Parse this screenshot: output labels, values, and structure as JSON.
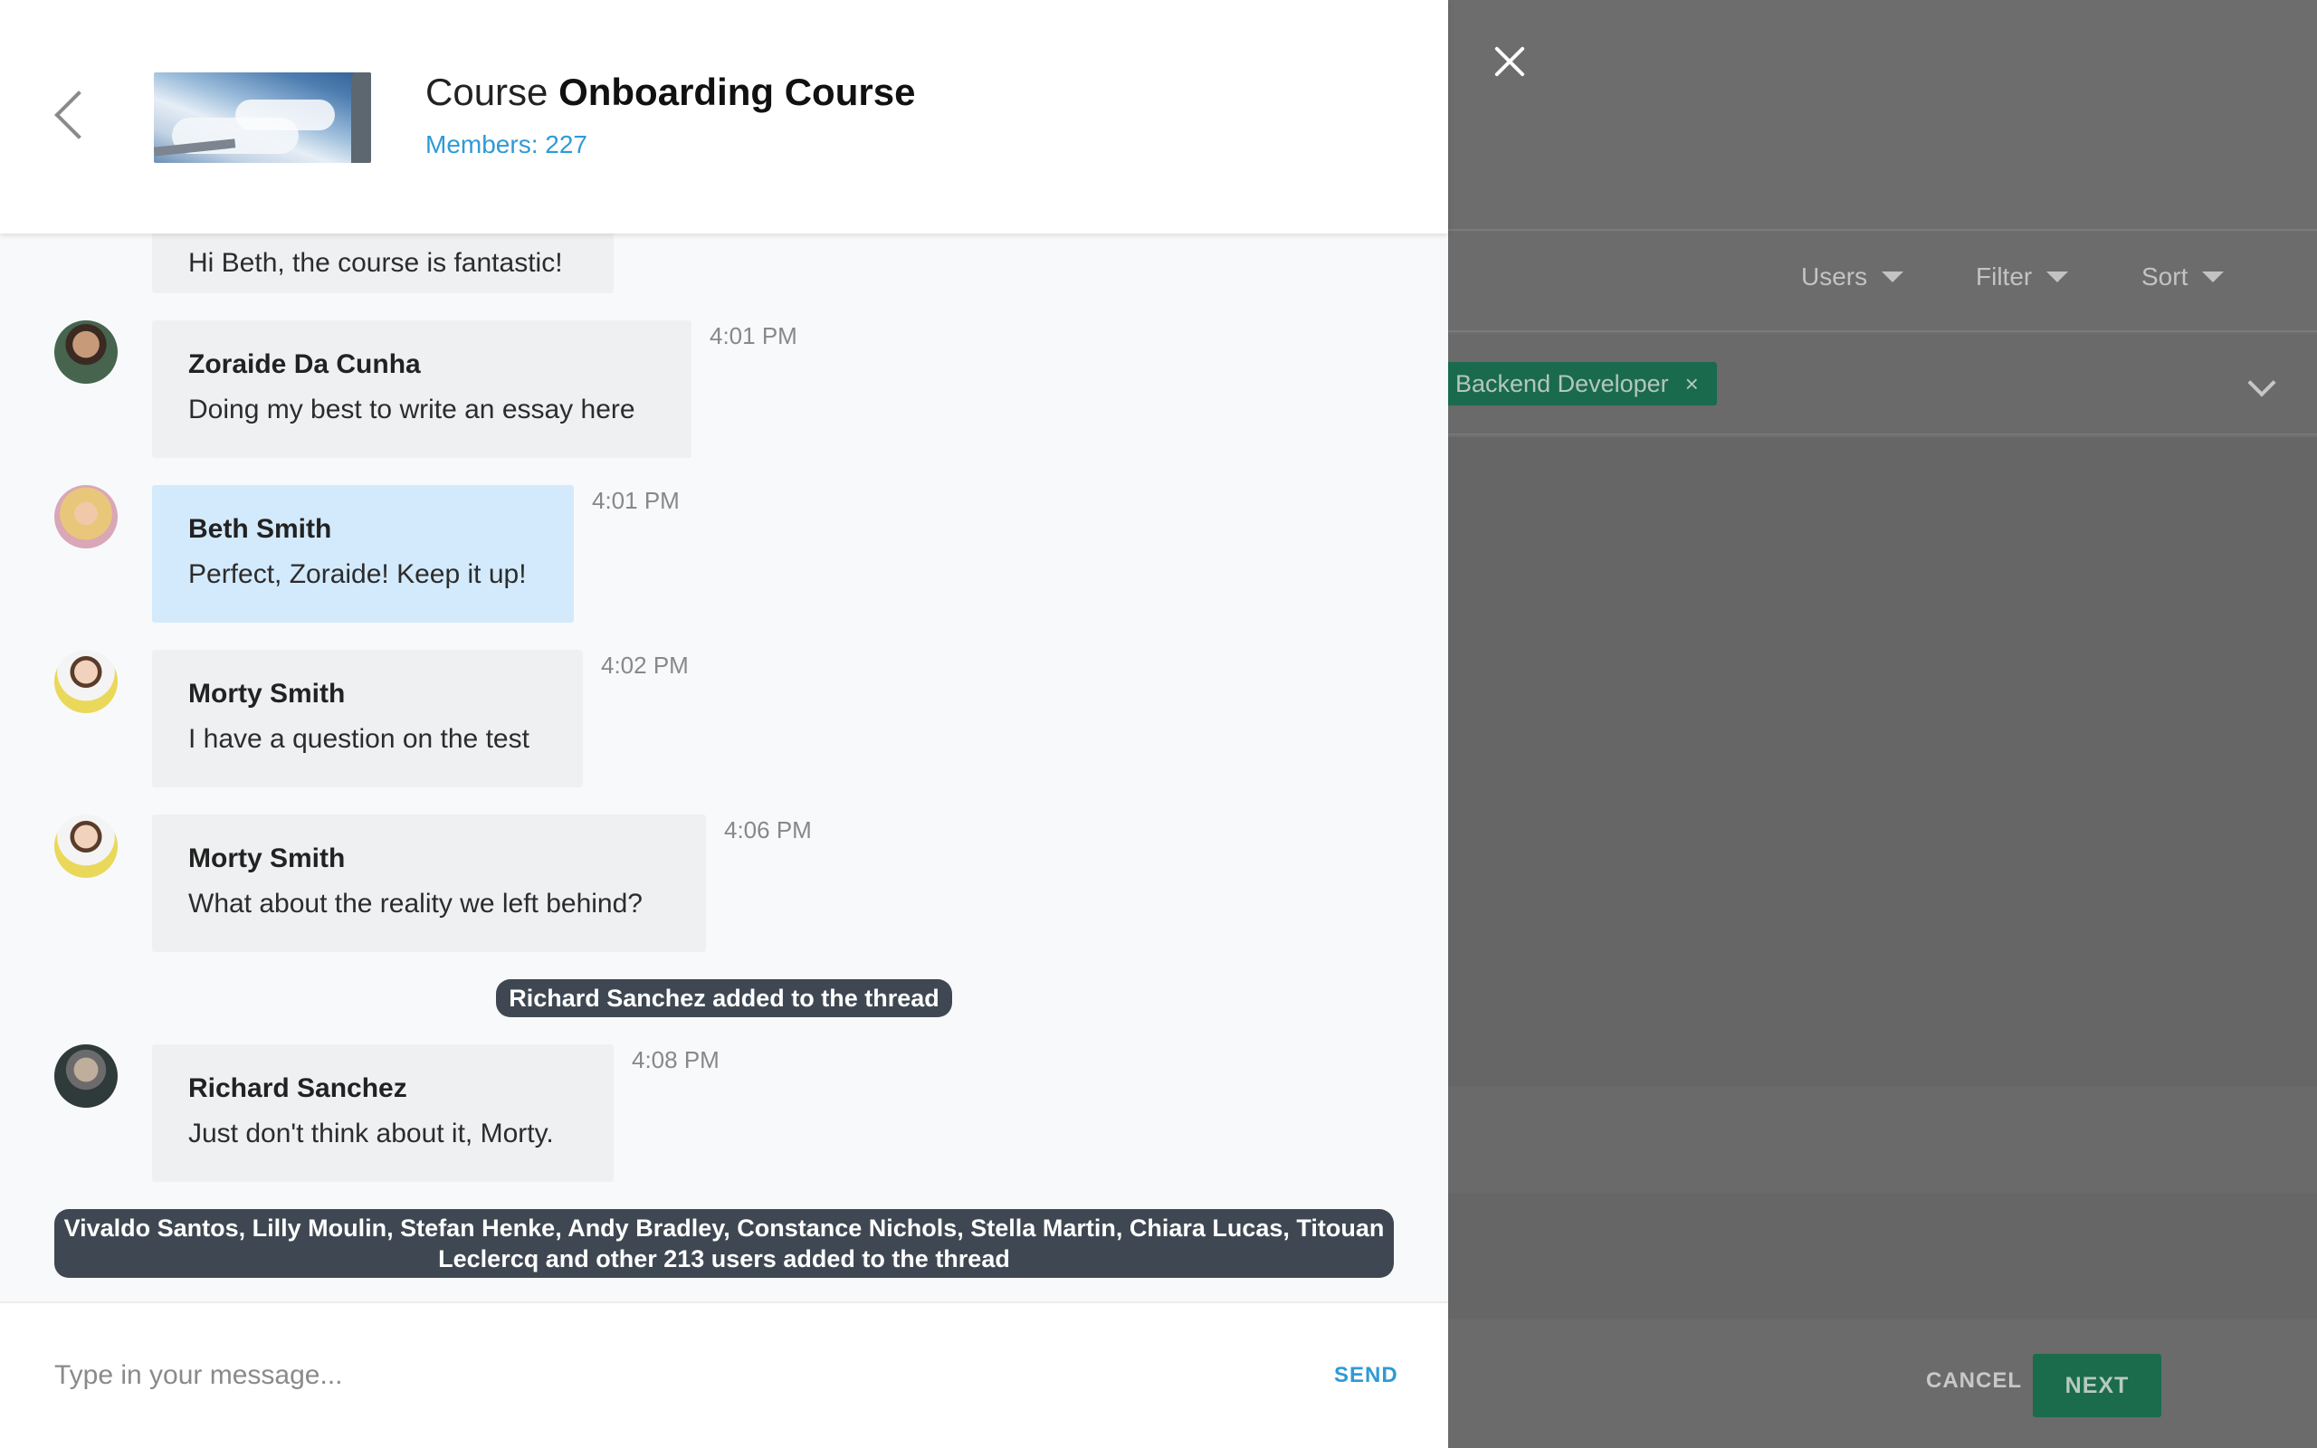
{
  "header": {
    "title_prefix": "Course",
    "title_name": "Onboarding Course",
    "members": "Members: 227"
  },
  "messages": [
    {
      "text": "Hi Beth, the course is fantastic!"
    },
    {
      "author": "Zoraide Da Cunha",
      "text": "Doing my best to write an essay here",
      "time": "4:01 PM"
    },
    {
      "author": "Beth Smith",
      "text": "Perfect, Zoraide! Keep it up!",
      "time": "4:01 PM",
      "mine": true
    },
    {
      "author": "Morty Smith",
      "text": "I have a question on the test",
      "time": "4:02 PM"
    },
    {
      "author": "Morty Smith",
      "text": "What about the reality we left behind?",
      "time": "4:06 PM"
    },
    {
      "author": "Richard Sanchez",
      "text": "Just don't think about it, Morty.",
      "time": "4:08 PM"
    }
  ],
  "system": {
    "added_one": "Richard Sanchez added to the thread",
    "added_many_line1": "Vivaldo Santos, Lilly Moulin, Stefan Henke, Andy Bradley, Constance Nichols, Stella Martin, Chiara Lucas, Titouan",
    "added_many_line2": "Leclercq and other 213 users added to the thread"
  },
  "composer": {
    "placeholder": "Type in your message...",
    "send_label": "SEND"
  },
  "background": {
    "dropdowns": [
      "Users",
      "Filter",
      "Sort"
    ],
    "chip_label": "n: Backend Developer",
    "chip_close": "×",
    "cancel_label": "CANCEL",
    "next_label": "NEXT"
  },
  "colors": {
    "accent_blue": "#2f9ad6",
    "own_bubble": "#d3eafc",
    "bubble": "#eff0f2",
    "system_pill": "#3f4852",
    "green": "#1b6b4d"
  }
}
